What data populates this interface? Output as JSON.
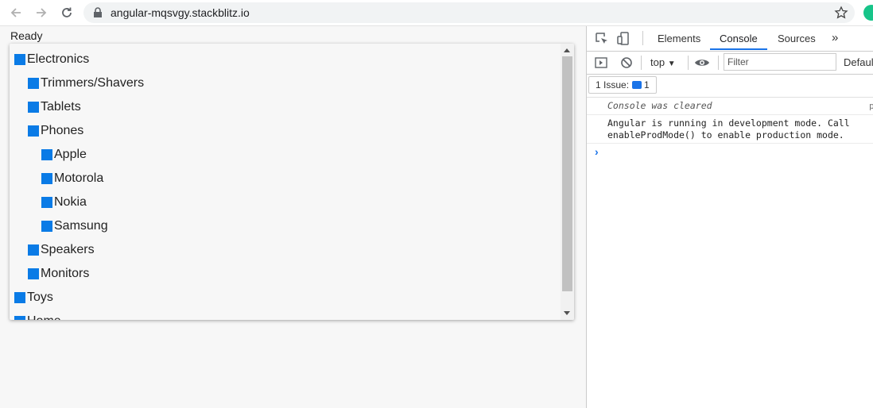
{
  "browser": {
    "url": "angular-mqsvgy.stackblitz.io"
  },
  "page": {
    "status": "Ready",
    "tree": [
      {
        "label": "Electronics",
        "level": 0
      },
      {
        "label": "Trimmers/Shavers",
        "level": 1
      },
      {
        "label": "Tablets",
        "level": 1
      },
      {
        "label": "Phones",
        "level": 1
      },
      {
        "label": "Apple",
        "level": 2
      },
      {
        "label": "Motorola",
        "level": 2
      },
      {
        "label": "Nokia",
        "level": 2
      },
      {
        "label": "Samsung",
        "level": 2
      },
      {
        "label": "Speakers",
        "level": 1
      },
      {
        "label": "Monitors",
        "level": 1
      },
      {
        "label": "Toys",
        "level": 0
      },
      {
        "label": "Home",
        "level": 0
      }
    ]
  },
  "devtools": {
    "tabs": [
      "Elements",
      "Console",
      "Sources"
    ],
    "active_tab": "Console",
    "more_tabs": "»",
    "context": "top",
    "filter_placeholder": "Filter",
    "levels": "Defaul",
    "issues_label": "1 Issue:",
    "issues_count": "1",
    "messages": [
      "Console was cleared",
      "Angular is running in development mode. Call",
      "enableProdMode() to enable production mode."
    ],
    "prompt": "›"
  },
  "colors": {
    "tree_square": "#0a7be6",
    "accent": "#1a73e8"
  }
}
